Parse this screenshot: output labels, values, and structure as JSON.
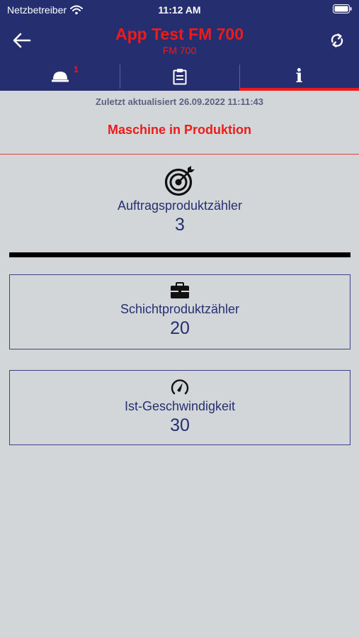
{
  "status_bar": {
    "carrier": "Netzbetreiber",
    "time": "11:12 AM"
  },
  "nav": {
    "title": "App Test FM 700",
    "subtitle": "FM 700"
  },
  "tabs": [
    {
      "icon": "alarm-light-icon",
      "badge": "1",
      "active": false
    },
    {
      "icon": "clipboard-icon",
      "active": false
    },
    {
      "icon": "info-icon",
      "label": "i",
      "active": true
    }
  ],
  "main": {
    "last_updated": "Zuletzt aktualisiert 26.09.2022 11:11:43",
    "machine_status": "Maschine in Produktion",
    "counters": [
      {
        "icon": "target-icon",
        "label": "Auftragsproduktzähler",
        "value": "3"
      },
      {
        "icon": "briefcase-icon",
        "label": "Schichtproduktzähler",
        "value": "20"
      },
      {
        "icon": "speedometer-icon",
        "label": "Ist-Geschwindigkeit",
        "value": "30"
      }
    ]
  },
  "colors": {
    "header_bg": "#252f6f",
    "accent_red": "#ee1b1b",
    "page_bg": "#d2d6d9",
    "text_navy": "#26306f"
  }
}
